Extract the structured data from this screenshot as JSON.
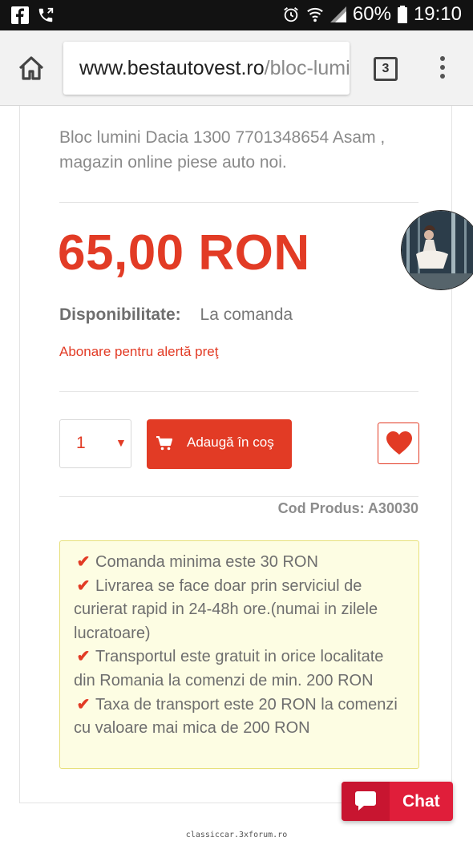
{
  "status_bar": {
    "battery": "60%",
    "time": "19:10",
    "icons": [
      "facebook-icon",
      "phone-icon",
      "alarm-icon",
      "wifi-icon",
      "signal-icon",
      "battery-icon"
    ]
  },
  "browser": {
    "url_domain": "www.bestautovest.ro",
    "url_path": "/bloc-lumini",
    "tab_count": "3"
  },
  "product": {
    "description": "Bloc lumini Dacia 1300 7701348654 Asam , magazin online piese auto noi.",
    "price": "65,00 RON",
    "availability_label": "Disponibilitate:",
    "availability_value": "La comanda",
    "price_alert_link": "Abonare pentru alertă preţ",
    "quantity": "1",
    "add_to_cart_label": "Adaugă în coş",
    "sku": "Cod Produs: A30030"
  },
  "notice": {
    "items": [
      "Comanda minima este 30 RON",
      "Livrarea se face doar prin serviciul de curierat rapid in 24-48h ore.(numai in zilele lucratoare)",
      "Transportul este gratuit in orice localitate din Romania la comenzi de min. 200 RON",
      "Taxa de transport este 20 RON la comenzi cu valoare mai mica de 200 RON"
    ]
  },
  "chat": {
    "label": "Chat"
  },
  "watermark": "classiccar.3xforum.ro",
  "colors": {
    "accent": "#e23b25",
    "chat": "#e01e3a",
    "notice_bg": "#fdfde3",
    "notice_border": "#e7e07a"
  }
}
